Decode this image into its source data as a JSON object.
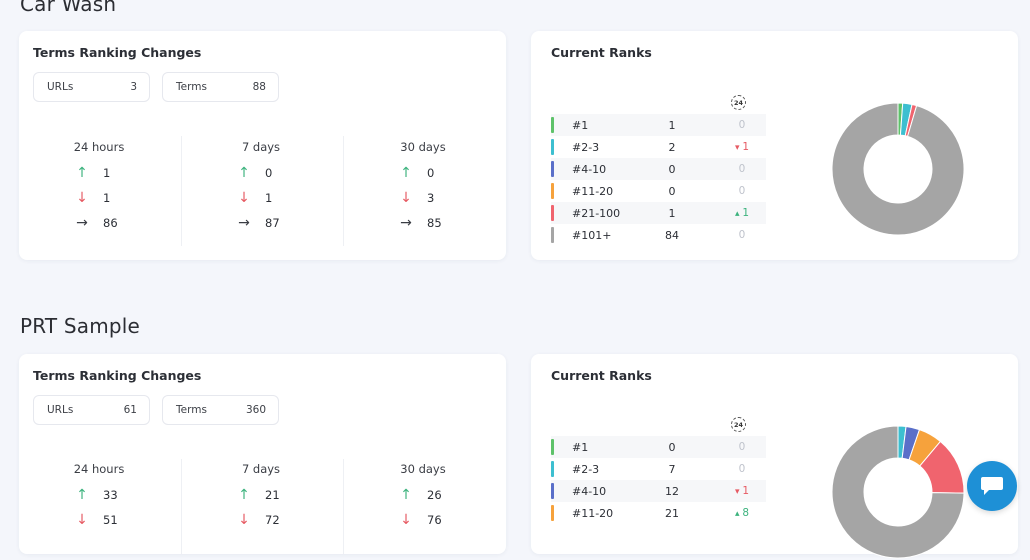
{
  "colors": {
    "rank_bars": [
      "#5ec26a",
      "#3dbfd0",
      "#5a6fc9",
      "#f6a23c",
      "#f0646e",
      "#a5a5a5"
    ],
    "up": "#3db37e",
    "down": "#e65a63",
    "chat_accent": "#1e90d6"
  },
  "icons": {
    "up": "arrow-up-icon",
    "down": "arrow-down-icon",
    "flat": "arrow-right-icon",
    "clock": "clock-24-icon",
    "chat": "chat-icon"
  },
  "projects": [
    {
      "title": "Car Wash",
      "ranking_changes": {
        "title": "Terms Ranking Changes",
        "urls_label": "URLs",
        "urls_value": "3",
        "terms_label": "Terms",
        "terms_value": "88",
        "periods": [
          {
            "label": "24 hours",
            "up": "1",
            "down": "1",
            "flat": "86"
          },
          {
            "label": "7 days",
            "up": "0",
            "down": "1",
            "flat": "87"
          },
          {
            "label": "30 days",
            "up": "0",
            "down": "3",
            "flat": "85"
          }
        ]
      },
      "current_ranks": {
        "title": "Current Ranks",
        "clock_label": "24",
        "rows": [
          {
            "label": "#1",
            "count": "1",
            "change": "0",
            "dir": "none"
          },
          {
            "label": "#2-3",
            "count": "2",
            "change": "1",
            "dir": "down"
          },
          {
            "label": "#4-10",
            "count": "0",
            "change": "0",
            "dir": "none"
          },
          {
            "label": "#11-20",
            "count": "0",
            "change": "0",
            "dir": "none"
          },
          {
            "label": "#21-100",
            "count": "1",
            "change": "1",
            "dir": "up"
          },
          {
            "label": "#101+",
            "count": "84",
            "change": "0",
            "dir": "none"
          }
        ]
      }
    },
    {
      "title": "PRT Sample",
      "ranking_changes": {
        "title": "Terms Ranking Changes",
        "urls_label": "URLs",
        "urls_value": "61",
        "terms_label": "Terms",
        "terms_value": "360",
        "periods": [
          {
            "label": "24 hours",
            "up": "33",
            "down": "51",
            "flat": ""
          },
          {
            "label": "7 days",
            "up": "21",
            "down": "72",
            "flat": ""
          },
          {
            "label": "30 days",
            "up": "26",
            "down": "76",
            "flat": ""
          }
        ]
      },
      "current_ranks": {
        "title": "Current Ranks",
        "clock_label": "24",
        "rows": [
          {
            "label": "#1",
            "count": "0",
            "change": "0",
            "dir": "none"
          },
          {
            "label": "#2-3",
            "count": "7",
            "change": "0",
            "dir": "none"
          },
          {
            "label": "#4-10",
            "count": "12",
            "change": "1",
            "dir": "down"
          },
          {
            "label": "#11-20",
            "count": "21",
            "change": "8",
            "dir": "up"
          }
        ]
      }
    }
  ],
  "chart_data": [
    {
      "type": "pie",
      "donut": true,
      "categories": [
        "#1",
        "#2-3",
        "#4-10",
        "#11-20",
        "#21-100",
        "#101+"
      ],
      "values": [
        1,
        2,
        0,
        0,
        1,
        84
      ]
    },
    {
      "type": "pie",
      "donut": true,
      "categories": [
        "#1",
        "#2-3",
        "#4-10",
        "#11-20",
        "#21-100",
        "#101+"
      ],
      "values": [
        0,
        7,
        12,
        21,
        51,
        269
      ]
    }
  ]
}
